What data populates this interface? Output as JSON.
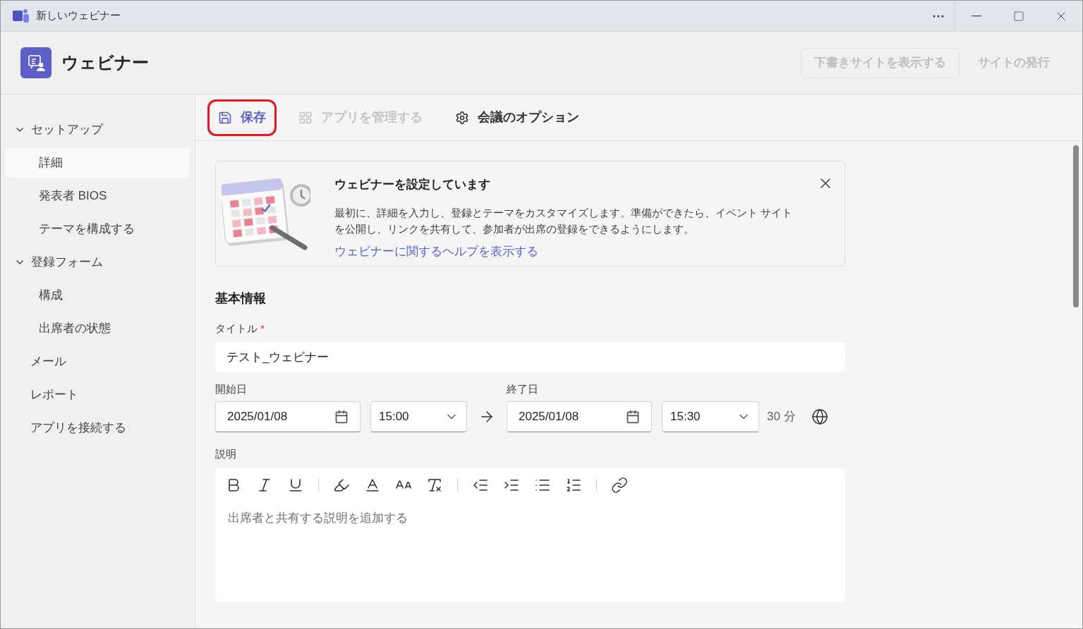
{
  "window": {
    "title": "新しいウェビナー"
  },
  "header": {
    "title": "ウェビナー",
    "buttons": [
      {
        "label": "下書きサイトを表示する",
        "kind": "outline",
        "disabled": true
      },
      {
        "label": "サイトの発行",
        "kind": "plain",
        "disabled": true
      }
    ]
  },
  "sidebar": {
    "items": [
      {
        "label": "セットアップ",
        "expanded": true,
        "children": [
          {
            "label": "詳細",
            "selected": true
          },
          {
            "label": "発表者 BIOS",
            "selected": false
          },
          {
            "label": "テーマを構成する",
            "selected": false
          }
        ]
      },
      {
        "label": "登録フォーム",
        "expanded": true,
        "children": [
          {
            "label": "構成",
            "selected": false
          },
          {
            "label": "出席者の状態",
            "selected": false
          }
        ]
      },
      {
        "label": "メール"
      },
      {
        "label": "レポート"
      },
      {
        "label": "アプリを接続する"
      }
    ]
  },
  "toolbar": [
    {
      "label": "保存",
      "kind": "save",
      "disabled": false,
      "highlighted": true
    },
    {
      "label": "アプリを管理する",
      "kind": "apps",
      "disabled": true,
      "highlighted": false
    },
    {
      "label": "会議のオプション",
      "kind": "options",
      "disabled": false,
      "highlighted": false
    }
  ],
  "banner": {
    "title": "ウェビナーを設定しています",
    "text": "最初に、詳細を入力し、登録とテーマをカスタマイズします。準備ができたら、イベント サイトを公開し、リンクを共有して、参加者が出席の登録をできるようにします。",
    "link": "ウェビナーに関するヘルプを表示する"
  },
  "form": {
    "section": "基本情報",
    "title_label": "タイトル",
    "required_mark": "*",
    "title_value": "テスト_ウェビナー",
    "start_label": "開始日",
    "start_date": "2025/01/08",
    "start_time": "15:00",
    "end_label": "終了日",
    "end_date": "2025/01/08",
    "end_time": "15:30",
    "duration": "30 分",
    "description_label": "説明",
    "description_placeholder": "出席者と共有する説明を追加する"
  }
}
